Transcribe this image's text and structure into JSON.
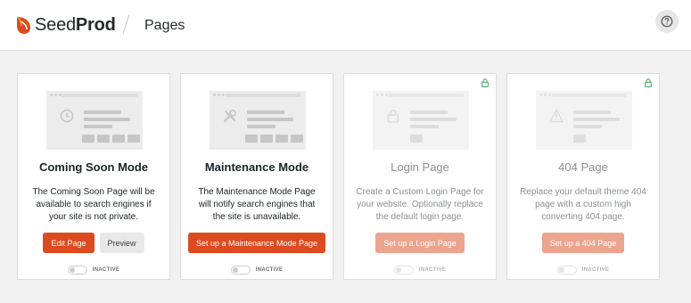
{
  "header": {
    "brand_prefix": "Seed",
    "brand_suffix": "Prod",
    "page_title": "Pages",
    "help_icon": "question-circle-icon"
  },
  "colors": {
    "accent": "#dd4a1f",
    "accent_faded": "#eca48f",
    "lock_green": "#3aa45a"
  },
  "cards": [
    {
      "title": "Coming Soon Mode",
      "description": "The Coming Soon Page will be available to search engines if your site is not private.",
      "primary_button": "Edit Page",
      "secondary_button": "Preview",
      "status": "INACTIVE",
      "icon": "clock-icon",
      "enabled": true
    },
    {
      "title": "Maintenance Mode",
      "description": "The Maintenance Mode Page will notify search engines that the site is unavailable.",
      "primary_button": "Set up a Maintenance Mode Page",
      "status": "INACTIVE",
      "icon": "tools-icon",
      "enabled": true
    },
    {
      "title": "Login Page",
      "description": "Create a Custom Login Page for your website. Optionally replace the default login page.",
      "primary_button": "Set up a Login Page",
      "status": "INACTIVE",
      "icon": "lock-icon",
      "enabled": false,
      "locked": true
    },
    {
      "title": "404 Page",
      "description": "Replace your default theme 404 page with a custom high converting 404 page.",
      "primary_button": "Set up a 404 Page",
      "status": "INACTIVE",
      "icon": "warning-icon",
      "enabled": false,
      "locked": true
    }
  ]
}
